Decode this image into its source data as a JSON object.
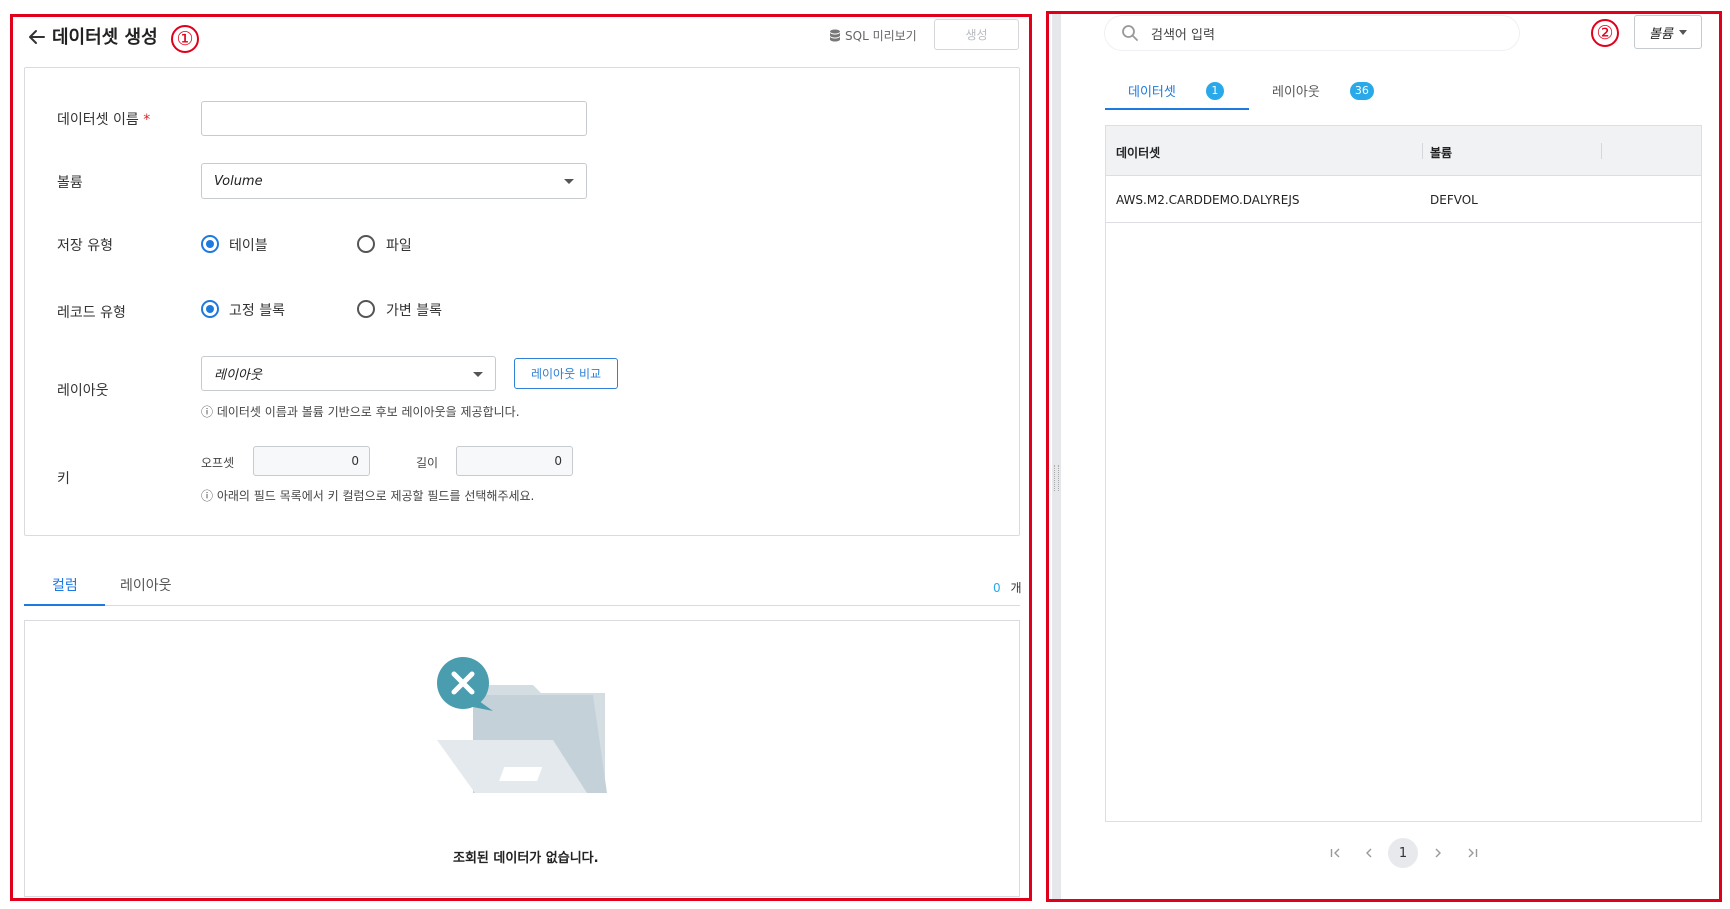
{
  "annotations": {
    "left_marker": "①",
    "right_marker": "②"
  },
  "header": {
    "title": "데이터셋 생성",
    "sql_preview_label": "SQL 미리보기",
    "create_label": "생성"
  },
  "form": {
    "dataset_name": {
      "label": "데이터셋 이름",
      "required_mark": "*",
      "value": ""
    },
    "volume": {
      "label": "볼륨",
      "selected": "Volume"
    },
    "storage_type": {
      "label": "저장 유형",
      "options": [
        "테이블",
        "파일"
      ],
      "selected": "테이블"
    },
    "record_type": {
      "label": "레코드 유형",
      "options": [
        "고정 블록",
        "가변 블록"
      ],
      "selected": "고정 블록"
    },
    "layout": {
      "label": "레이아웃",
      "selected": "레이아웃",
      "compare_label": "레이아웃 비교",
      "hint": "ⓘ 데이터셋 이름과 볼륨 기반으로 후보 레이아웃을 제공합니다."
    },
    "key": {
      "label": "키",
      "offset_label": "오프셋",
      "offset_value": "0",
      "length_label": "길이",
      "length_value": "0",
      "hint": "ⓘ 아래의 필드 목록에서 키 컬럼으로 제공할 필드를 선택해주세요."
    }
  },
  "bottom_tabs": {
    "tabs": [
      "컬럼",
      "레이아웃"
    ],
    "active": "컬럼",
    "count": "0",
    "count_unit": "개"
  },
  "empty_state": {
    "message": "조회된 데이터가 없습니다."
  },
  "right_panel": {
    "search_placeholder": "검색어 입력",
    "volume_filter": "볼륨",
    "tabs": [
      {
        "label": "데이터셋",
        "badge": "1"
      },
      {
        "label": "레이아웃",
        "badge": "36"
      }
    ],
    "active_tab": "데이터셋",
    "columns": [
      "데이터셋",
      "볼륨"
    ],
    "rows": [
      {
        "dataset": "AWS.M2.CARDDEMO.DALYREJS",
        "volume": "DEFVOL"
      }
    ],
    "pagination": {
      "current": "1"
    }
  },
  "colors": {
    "accent": "#1f7ae0",
    "badge": "#29a9e9",
    "annotation": "#e0001b"
  }
}
